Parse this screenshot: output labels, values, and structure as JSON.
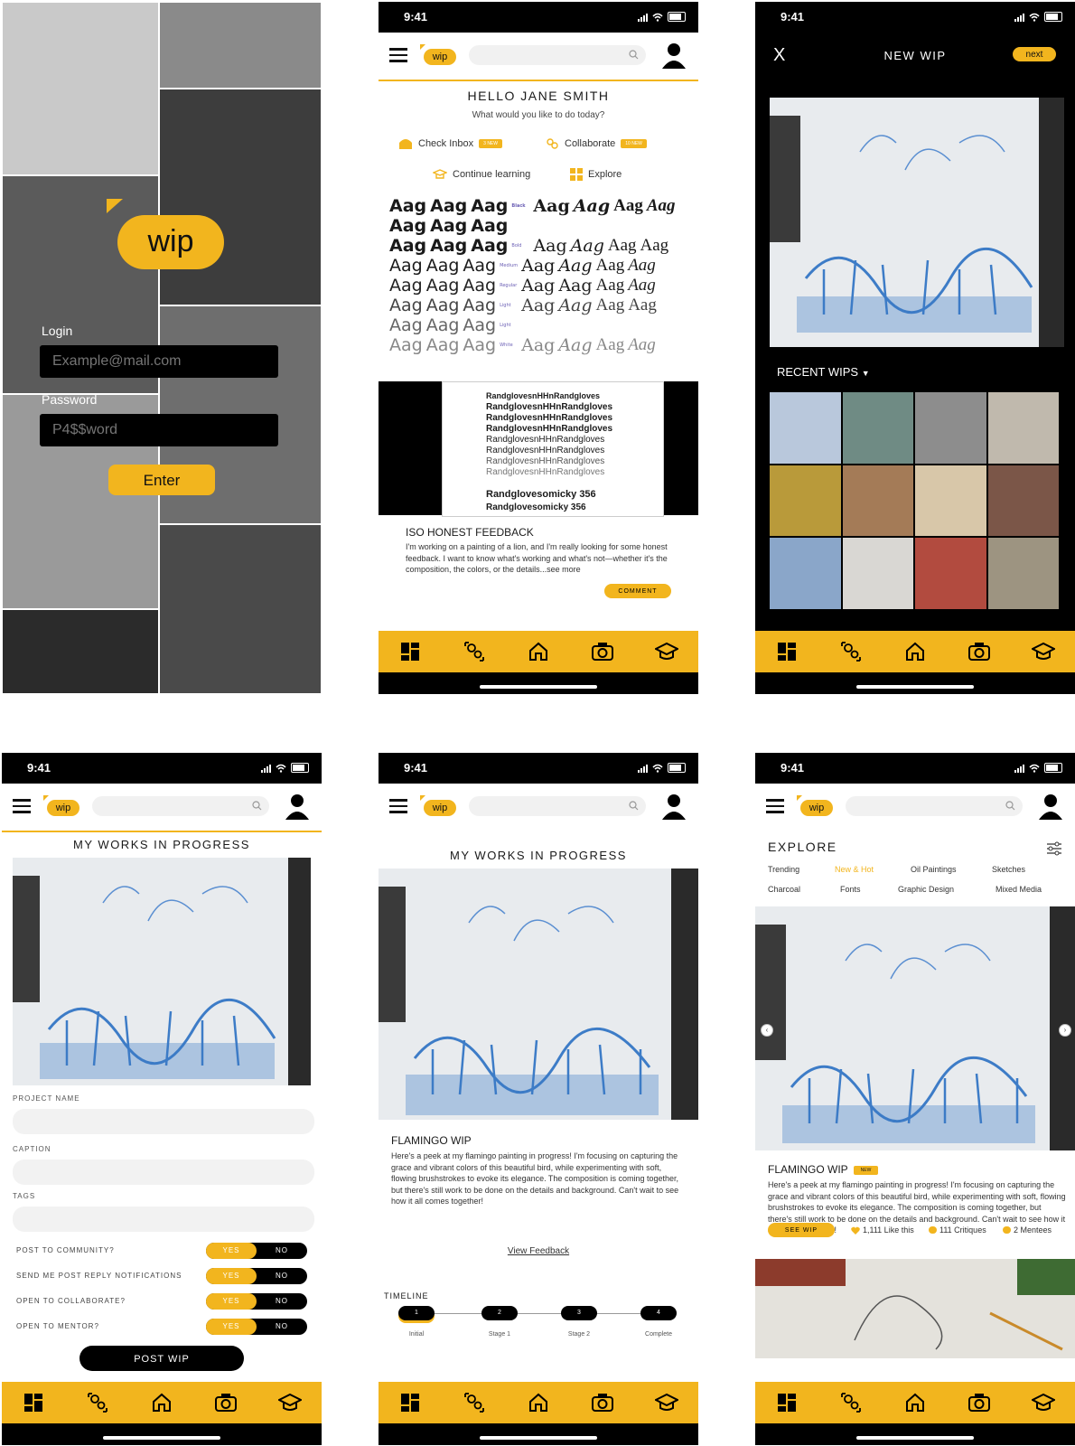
{
  "status_time": "9:41",
  "login": {
    "logo": "wip",
    "login_label": "Login",
    "email_placeholder": "Example@mail.com",
    "password_label": "Password",
    "password_placeholder": "P4$$word",
    "enter_label": "Enter"
  },
  "appbar": {
    "logo": "wip"
  },
  "home": {
    "greeting": "HELLO JANE SMITH",
    "subtitle": "What would you like to do today?",
    "actions": [
      {
        "label": "Check Inbox",
        "badge": "3 NEW",
        "icon": "inbox-icon"
      },
      {
        "label": "Collaborate",
        "badge": "10 NEW",
        "icon": "collaborate-icon"
      },
      {
        "label": "Continue learning",
        "icon": "learning-icon"
      },
      {
        "label": "Explore",
        "icon": "explore-icon"
      }
    ],
    "specimen_text": "Aag",
    "mock_lines": [
      "RandglovesnHHnRandgloves",
      "RandglovesnHHnRandgloves",
      "RandglovesnHHnRandgloves",
      "RandglovesnHHnRandgloves",
      "RandglovesnHHnRandgloves",
      "RandglovesnHHnRandgloves",
      "RandglovesnHHnRandgloves",
      "RandglovesnHHnRandgloves"
    ],
    "mock_big1": "Randglovesomicky 356",
    "mock_big2": "Randglovesomicky 356",
    "post_title": "ISO HONEST FEEDBACK",
    "post_body": "I'm working on a painting of a lion, and I'm really looking for some honest feedback. I want to know what's working and what's not—whether it's the composition, the colors, or the details...see more",
    "comment_label": "COMMENT"
  },
  "new_wip": {
    "close": "X",
    "title": "NEW WIP",
    "next_label": "next",
    "recent_label": "RECENT WIPS"
  },
  "form": {
    "title": "MY WORKS IN PROGRESS",
    "project_name_label": "PROJECT NAME",
    "caption_label": "CAPTION",
    "tags_label": "TAGS",
    "toggles": [
      {
        "label": "POST TO COMMUNITY?",
        "yes": "YES",
        "no": "NO"
      },
      {
        "label": "SEND ME POST REPLY NOTIFICATIONS",
        "yes": "YES",
        "no": "NO"
      },
      {
        "label": "OPEN TO COLLABORATE?",
        "yes": "YES",
        "no": "NO"
      },
      {
        "label": "OPEN TO MENTOR?",
        "yes": "YES",
        "no": "NO"
      }
    ],
    "post_label": "POST WIP"
  },
  "detail": {
    "title": "MY WORKS IN PROGRESS",
    "wip_title": "FLAMINGO WIP",
    "wip_body": "Here's a peek at my flamingo painting in progress! I'm focusing on capturing the grace and vibrant colors of this beautiful bird, while experimenting with soft, flowing brushstrokes to evoke its elegance. The composition is coming together, but there's still work to be done on the details and background. Can't wait to see how it all comes together!",
    "view_feedback": "View Feedback",
    "timeline_label": "TIMELINE",
    "stages": [
      {
        "num": "1",
        "label": "Initial"
      },
      {
        "num": "2",
        "label": "Stage 1"
      },
      {
        "num": "3",
        "label": "Stage 2"
      },
      {
        "num": "4",
        "label": "Complete"
      }
    ]
  },
  "explore": {
    "title": "EXPLORE",
    "categories": [
      "Trending",
      "New & Hot",
      "Oil Paintings",
      "Sketches",
      "Charcoal",
      "Fonts",
      "Graphic Design",
      "Mixed Media"
    ],
    "active_category": "New & Hot",
    "wip_title": "FLAMINGO WIP",
    "new_badge": "NEW",
    "wip_body": "Here's a peek at my flamingo painting in progress! I'm focusing on capturing the grace and vibrant colors of this beautiful bird, while experimenting with soft, flowing brushstrokes to evoke its elegance. The composition is coming together, but there's still work to be done on the details and background. Can't wait to see how it all comes together!",
    "see_wip": "SEE WIP",
    "likes": "1,111 Like this",
    "critiques": "111 Critiques",
    "mentees": "2 Mentees"
  },
  "colors": {
    "accent": "#f2b51e",
    "dark": "#000000"
  }
}
